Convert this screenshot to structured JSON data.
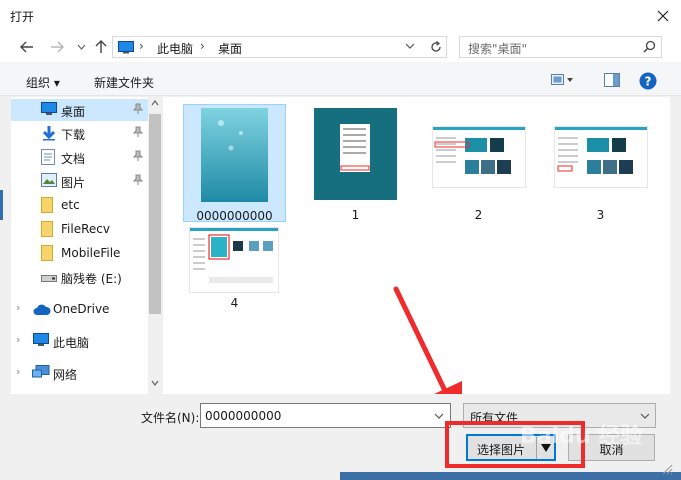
{
  "window": {
    "title": "打开"
  },
  "nav": {
    "address": [
      "此电脑",
      "桌面"
    ],
    "search_placeholder": "搜索\"桌面\""
  },
  "toolbar": {
    "organize": "组织 ▾",
    "new_folder": "新建文件夹"
  },
  "sidebar": {
    "items": [
      {
        "label": "桌面",
        "icon": "desktop-icon"
      },
      {
        "label": "下载",
        "icon": "download-icon"
      },
      {
        "label": "文档",
        "icon": "document-icon"
      },
      {
        "label": "图片",
        "icon": "picture-icon"
      },
      {
        "label": "etc",
        "icon": "folder-icon"
      },
      {
        "label": "FileRecv",
        "icon": "folder-icon"
      },
      {
        "label": "MobileFile",
        "icon": "folder-icon"
      },
      {
        "label": "脑残卷 (E:)",
        "icon": "drive-icon"
      },
      {
        "label": "OneDrive",
        "icon": "cloud-icon"
      },
      {
        "label": "此电脑",
        "icon": "computer-icon"
      },
      {
        "label": "网络",
        "icon": "network-icon"
      }
    ]
  },
  "files": [
    {
      "name": "0000000000",
      "selected": true
    },
    {
      "name": "1"
    },
    {
      "name": "2"
    },
    {
      "name": "3"
    },
    {
      "name": "4"
    }
  ],
  "footer": {
    "filename_label": "文件名(N):",
    "filename_value": "0000000000",
    "filetype_value": "所有文件",
    "open_button": "选择图片",
    "cancel_button": "取消"
  },
  "watermark": "Baidu 经验",
  "colors": {
    "selection": "#cce8ff",
    "accent": "#0078d7",
    "annotation": "#ef2b2b"
  }
}
